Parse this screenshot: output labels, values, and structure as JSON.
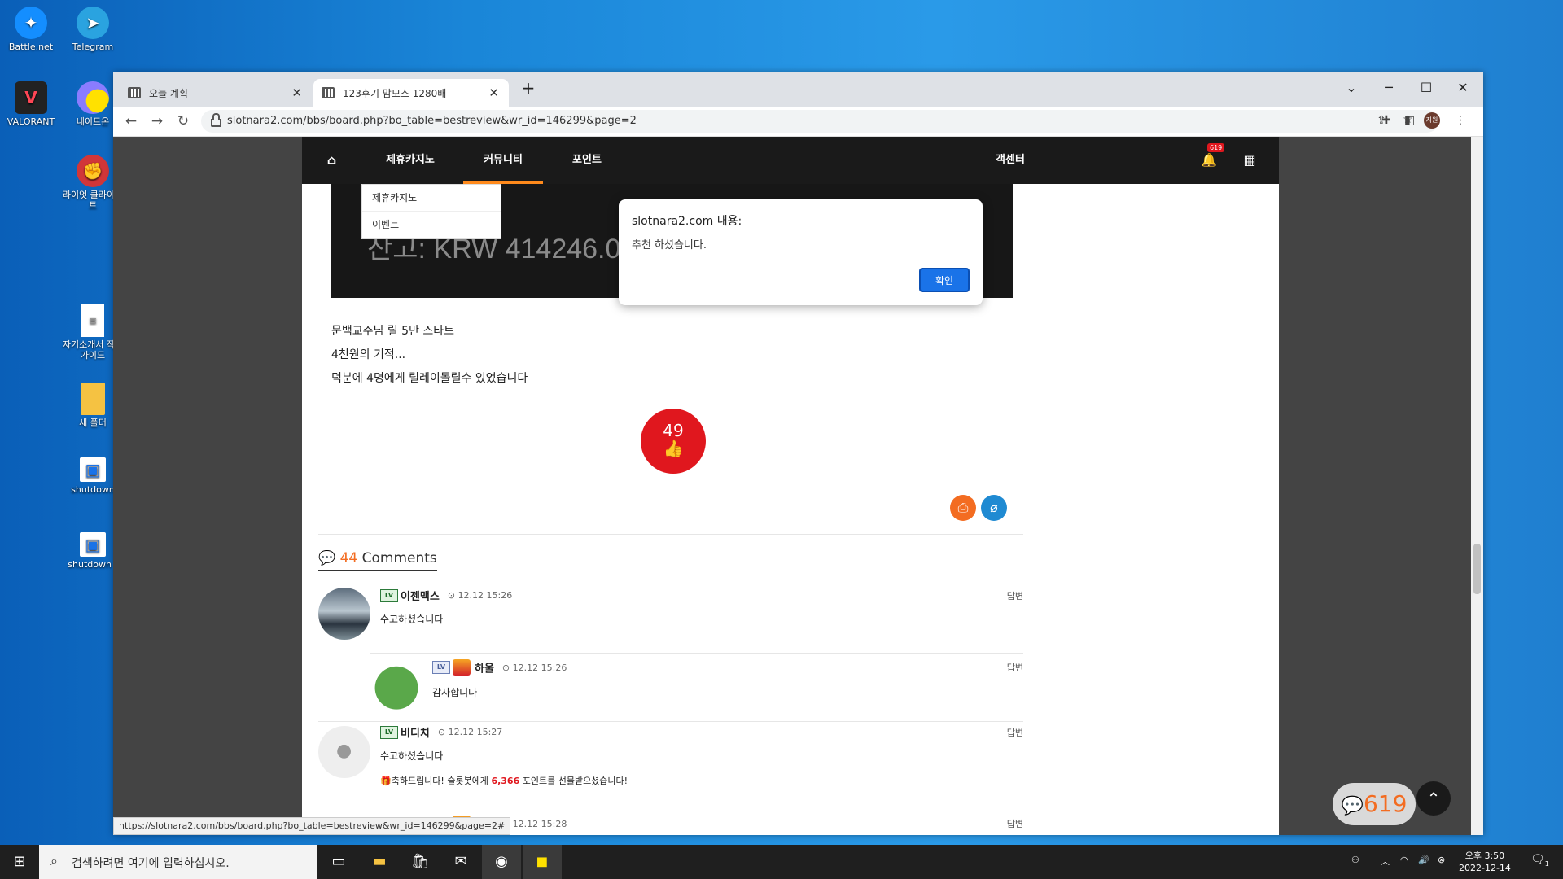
{
  "desktop": {
    "icons": [
      {
        "label": "Battle.net",
        "icon": "battlenet-icon"
      },
      {
        "label": "Telegram",
        "icon": "telegram-icon"
      },
      {
        "label": "VALORANT",
        "icon": "valorant-icon"
      },
      {
        "label": "네이트온",
        "icon": "nateon-icon"
      },
      {
        "label": "라이엇 클라이언트",
        "icon": "riot-client-icon"
      },
      {
        "label": "자기소개서 작성 가이드",
        "icon": "document-icon"
      },
      {
        "label": "새 폴더",
        "icon": "folder-icon"
      },
      {
        "label": "shutdown",
        "icon": "shortcut-icon"
      },
      {
        "label": "shutdown (",
        "icon": "shortcut-icon"
      }
    ]
  },
  "browser": {
    "tabs": [
      {
        "label": "오늘 계획",
        "active": false
      },
      {
        "label": "123후기 맘모스 1280배",
        "active": true
      }
    ],
    "new_tab": "+",
    "url": "slotnara2.com/bbs/board.php?bo_table=bestreview&wr_id=146299&page=2",
    "profile_label": "지원",
    "status_url": "https://slotnara2.com/bbs/board.php?bo_table=bestreview&wr_id=146299&page=2#"
  },
  "site": {
    "nav": {
      "home_icon": "home-icon",
      "items": [
        "제휴카지노",
        "커뮤니티",
        "포인트",
        "객센터"
      ],
      "notification_count": "619",
      "dropdown": [
        "제휴카지노",
        "이벤트"
      ]
    },
    "post": {
      "image_text": "잔고: KRW 414246.00",
      "lines": [
        "문백교주님 릴 5만 스타트",
        "4천원의 기적...",
        "덕분에 4명에게 릴레이돌릴수 있었습니다"
      ],
      "likes": "49"
    },
    "comments": {
      "count": "44",
      "label": "Comments",
      "reply_label": "답변",
      "items": [
        {
          "level": "LV",
          "name": "이젠맥스",
          "time": "12.12 15:26",
          "text": "수고하셨습니다"
        },
        {
          "level": "LV",
          "name": "하울",
          "time": "12.12 15:26",
          "text": "감사합니다"
        },
        {
          "level": "LV",
          "name": "비디치",
          "time": "12.12 15:27",
          "text": "수고하셨습니다",
          "gift_prefix": "축하드립니다! 슬롯봇에게 ",
          "gift_points": "6,366",
          "gift_suffix": " 포인트를 선물받으셨습니다!"
        },
        {
          "level": "LV",
          "name": "하울",
          "time": "12.12 15:28",
          "text": ""
        }
      ]
    },
    "floating_chat_count": "619"
  },
  "alert": {
    "title": "slotnara2.com 내용:",
    "message": "추천 하셨습니다.",
    "ok_label": "확인"
  },
  "taskbar": {
    "search_placeholder": "검색하려면 여기에 입력하십시오.",
    "time": "오후 3:50",
    "date": "2022-12-14",
    "notification_count": "1"
  },
  "colors": {
    "accent_orange": "#f36c21",
    "like_red": "#e0171e",
    "chrome_blue": "#1a73e8"
  }
}
